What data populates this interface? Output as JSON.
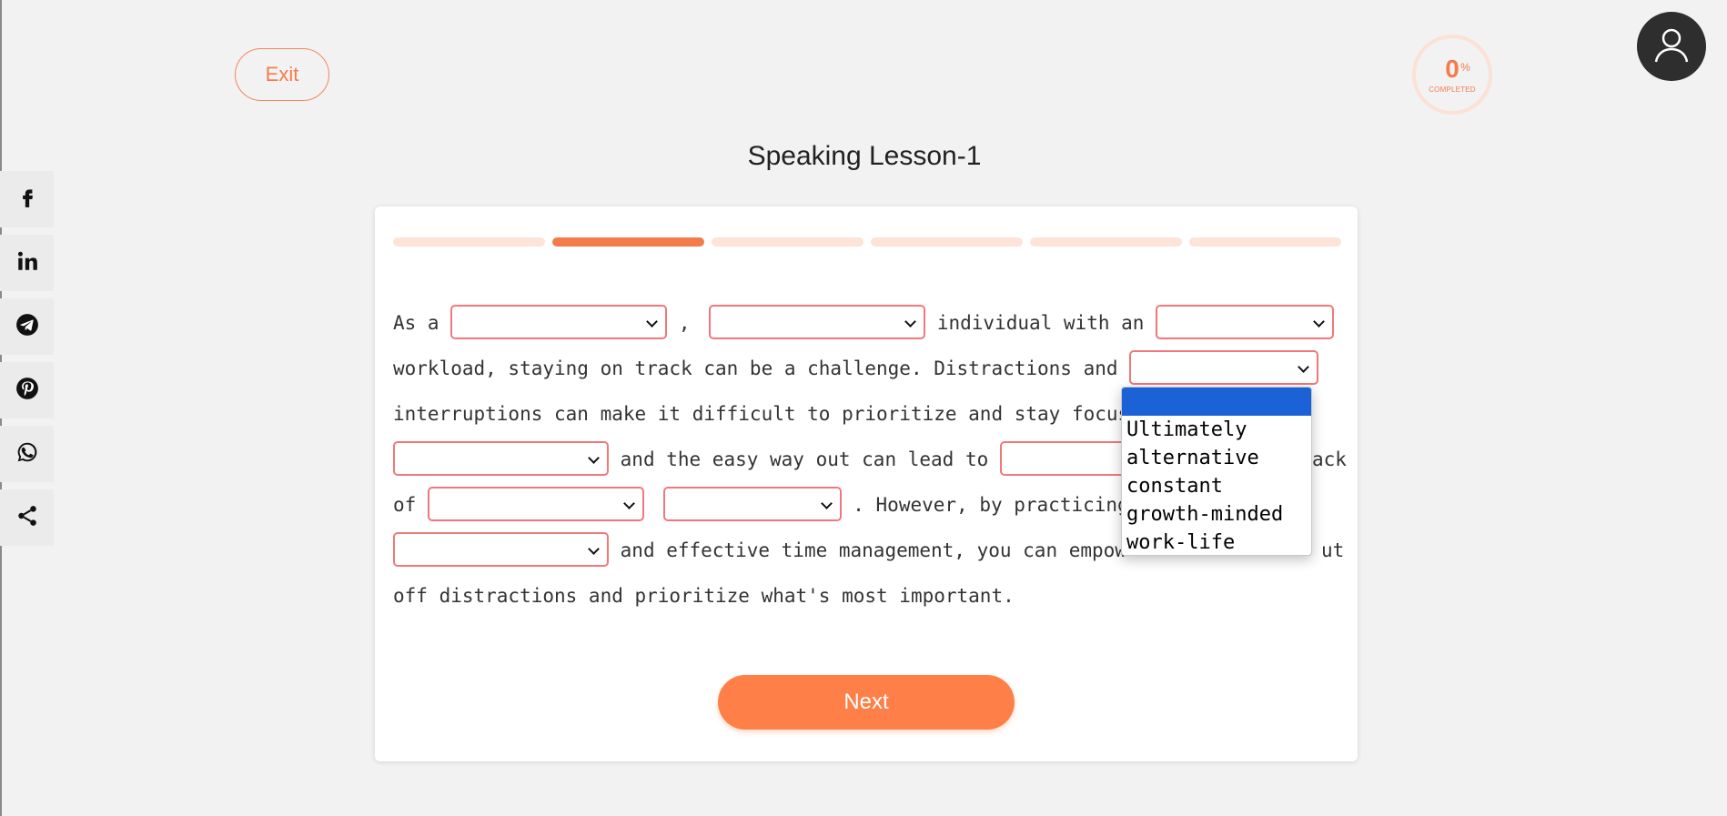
{
  "header": {
    "exit_label": "Exit",
    "progress_value": "0",
    "progress_unit": "%",
    "progress_label": "COMPLETED"
  },
  "lesson": {
    "title": "Speaking Lesson-1",
    "steps_total": 6,
    "active_step": 2
  },
  "social": [
    "facebook-icon",
    "linkedin-icon",
    "telegram-icon",
    "pinterest-icon",
    "whatsapp-icon",
    "share-icon"
  ],
  "passage": {
    "l1_a": "As a ",
    "l1_b": ",",
    "l1_c": " individual with an ",
    "l2_a": "workload, staying on track can be a challenge. Distractions and ",
    "l3_a": "interruptions can make it difficult to prioritize and stay focus",
    "l4_a": " and the easy way out can lead to ",
    "l4_b": "ack",
    "l5_a": " of ",
    "l5_b": ". However, by practicing ",
    "l6_a": " and effective time management, you can empow",
    "l6_b": "ut",
    "l7_a": "off distractions and prioritize what's most important."
  },
  "dropdown": {
    "selected": "",
    "options": [
      "Ultimately",
      "alternative",
      "constant",
      "growth-minded",
      "work-life"
    ]
  },
  "next_label": "Next",
  "colors": {
    "accent": "#f47c4c",
    "button": "#fe8048",
    "blank_border": "#f3777a",
    "dropdown_highlight": "#1a62d6"
  }
}
